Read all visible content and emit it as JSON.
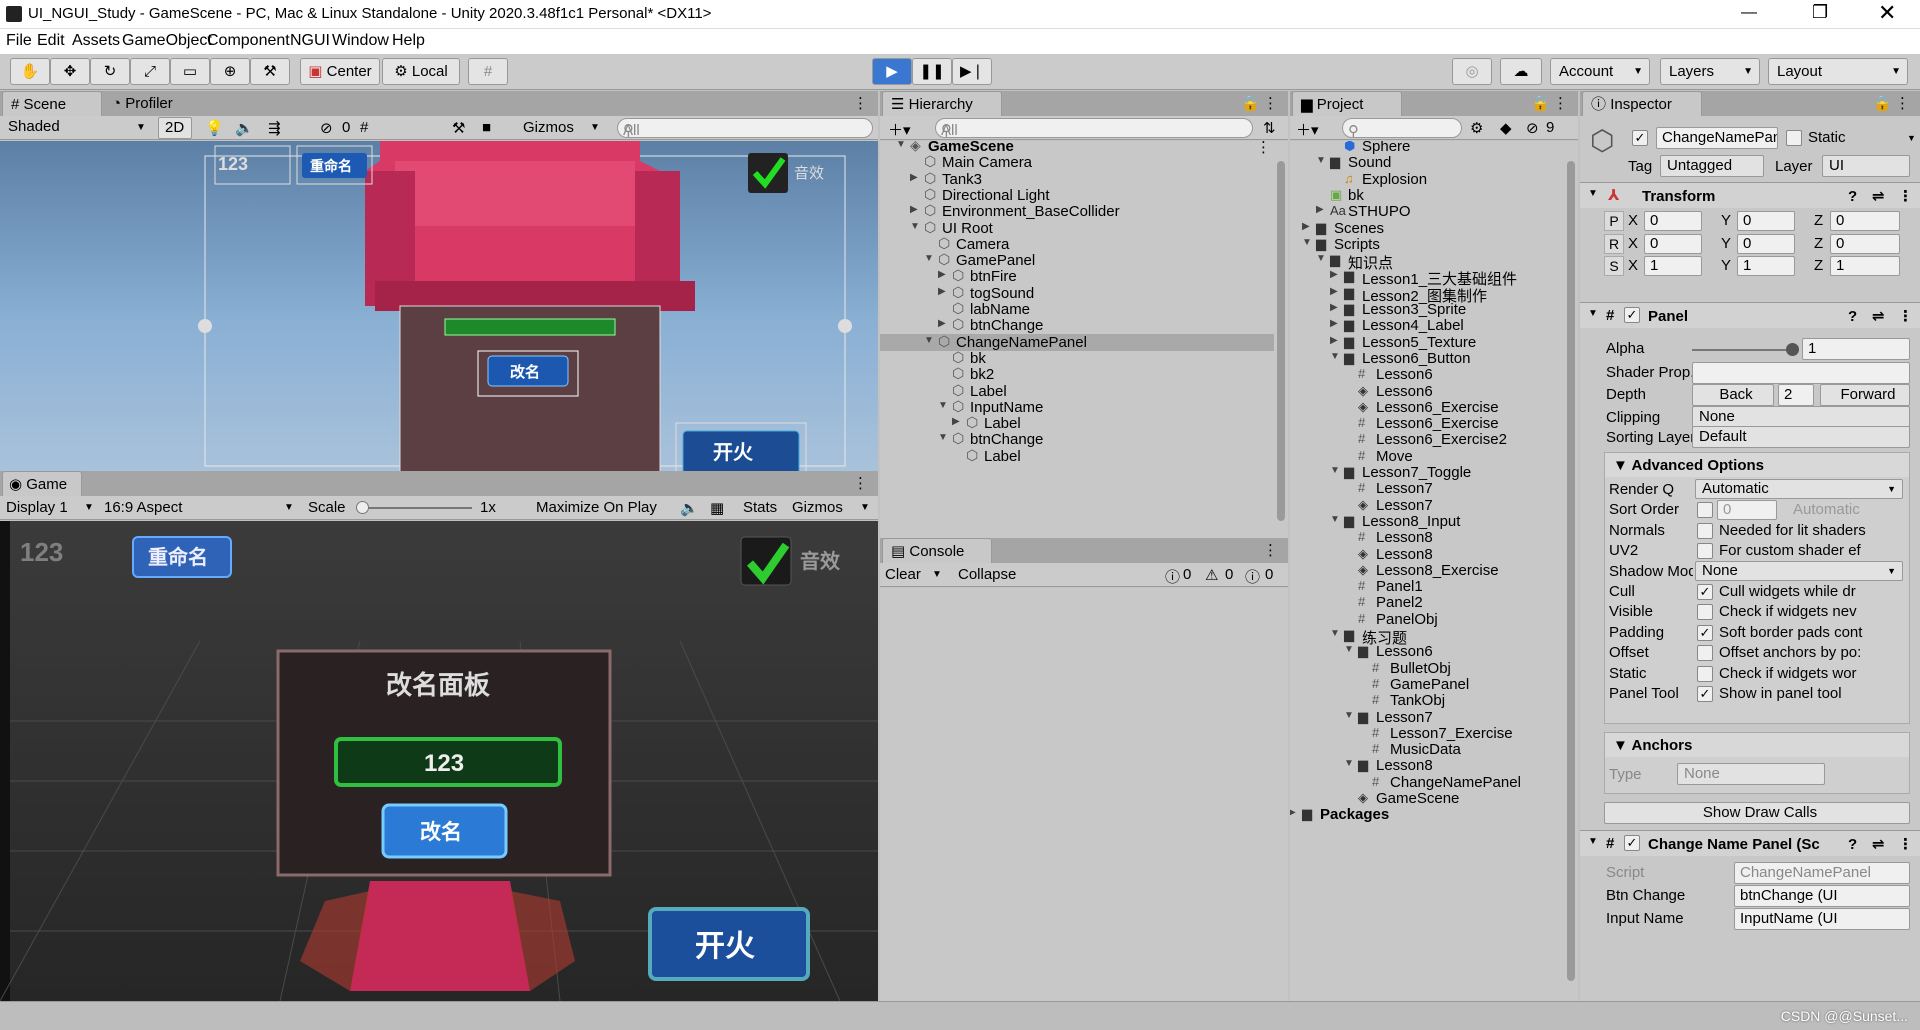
{
  "window": {
    "title": "UI_NGUI_Study - GameScene - PC, Mac & Linux Standalone - Unity 2020.3.48f1c1 Personal* <DX11>"
  },
  "menu": [
    "File",
    "Edit",
    "Assets",
    "GameObject",
    "Component",
    "NGUI",
    "Window",
    "Help"
  ],
  "toolbar": {
    "center": "Center",
    "local": "Local",
    "account": "Account",
    "layers": "Layers",
    "layout": "Layout"
  },
  "scene": {
    "tab": "Scene",
    "profiler_tab": "Profiler",
    "shading": "Shaded",
    "mode2d": "2D",
    "hidden_count": "0",
    "gizmos": "Gizmos",
    "search": "All",
    "overlay": {
      "label_123": "123",
      "rename_btn": "重命名",
      "sound_label": "音效",
      "rename2": "改名",
      "fire": "开火"
    }
  },
  "game": {
    "tab": "Game",
    "display": "Display 1",
    "aspect": "16:9 Aspect",
    "scale_label": "Scale",
    "scale_value": "1x",
    "maximize": "Maximize On Play",
    "stats": "Stats",
    "gizmos": "Gizmos",
    "ui": {
      "label_123": "123",
      "rename_btn": "重命名",
      "sound_label": "音效",
      "panel_title": "改名面板",
      "input_value": "123",
      "change_btn": "改名",
      "fire_btn": "开火"
    }
  },
  "hierarchy": {
    "tab": "Hierarchy",
    "search": "All",
    "items": [
      {
        "label": "GameScene",
        "depth": 0,
        "arrow": "down",
        "scene": true
      },
      {
        "label": "Main Camera",
        "depth": 1
      },
      {
        "label": "Tank3",
        "depth": 1,
        "arrow": "right"
      },
      {
        "label": "Directional Light",
        "depth": 1
      },
      {
        "label": "Environment_BaseCollider",
        "depth": 1,
        "arrow": "right"
      },
      {
        "label": "UI Root",
        "depth": 1,
        "arrow": "down"
      },
      {
        "label": "Camera",
        "depth": 2
      },
      {
        "label": "GamePanel",
        "depth": 2,
        "arrow": "down"
      },
      {
        "label": "btnFire",
        "depth": 3,
        "arrow": "right"
      },
      {
        "label": "togSound",
        "depth": 3,
        "arrow": "right"
      },
      {
        "label": "labName",
        "depth": 3
      },
      {
        "label": "btnChange",
        "depth": 3,
        "arrow": "right"
      },
      {
        "label": "ChangeNamePanel",
        "depth": 2,
        "arrow": "down",
        "selected": true
      },
      {
        "label": "bk",
        "depth": 3
      },
      {
        "label": "bk2",
        "depth": 3
      },
      {
        "label": "Label",
        "depth": 3
      },
      {
        "label": "InputName",
        "depth": 3,
        "arrow": "down"
      },
      {
        "label": "Label",
        "depth": 4,
        "arrow": "right"
      },
      {
        "label": "btnChange",
        "depth": 3,
        "arrow": "down"
      },
      {
        "label": "Label",
        "depth": 4
      }
    ]
  },
  "console": {
    "tab": "Console",
    "clear": "Clear",
    "collapse": "Collapse",
    "info_count": "0",
    "warn_count": "0",
    "error_count": "0"
  },
  "project": {
    "tab": "Project",
    "hidden_count": "9",
    "items": [
      {
        "label": "Sphere",
        "depth": 3,
        "icon": "prefab"
      },
      {
        "label": "Sound",
        "depth": 2,
        "icon": "folder",
        "arrow": "down"
      },
      {
        "label": "Explosion",
        "depth": 3,
        "icon": "audio"
      },
      {
        "label": "bk",
        "depth": 2,
        "icon": "image"
      },
      {
        "label": "STHUPO",
        "depth": 2,
        "icon": "font",
        "arrow": "right"
      },
      {
        "label": "Scenes",
        "depth": 1,
        "icon": "folder",
        "arrow": "right"
      },
      {
        "label": "Scripts",
        "depth": 1,
        "icon": "folder",
        "arrow": "down"
      },
      {
        "label": "知识点",
        "depth": 2,
        "icon": "folder",
        "arrow": "down"
      },
      {
        "label": "Lesson1_三大基础组件",
        "depth": 3,
        "icon": "folder",
        "arrow": "right"
      },
      {
        "label": "Lesson2_图集制作",
        "depth": 3,
        "icon": "folder",
        "arrow": "right"
      },
      {
        "label": "Lesson3_Sprite",
        "depth": 3,
        "icon": "folder",
        "arrow": "right"
      },
      {
        "label": "Lesson4_Label",
        "depth": 3,
        "icon": "folder",
        "arrow": "right"
      },
      {
        "label": "Lesson5_Texture",
        "depth": 3,
        "icon": "folder",
        "arrow": "right"
      },
      {
        "label": "Lesson6_Button",
        "depth": 3,
        "icon": "folder",
        "arrow": "down"
      },
      {
        "label": "Lesson6",
        "depth": 4,
        "icon": "script"
      },
      {
        "label": "Lesson6",
        "depth": 4,
        "icon": "scene"
      },
      {
        "label": "Lesson6_Exercise",
        "depth": 4,
        "icon": "scene"
      },
      {
        "label": "Lesson6_Exercise",
        "depth": 4,
        "icon": "script"
      },
      {
        "label": "Lesson6_Exercise2",
        "depth": 4,
        "icon": "script"
      },
      {
        "label": "Move",
        "depth": 4,
        "icon": "script"
      },
      {
        "label": "Lesson7_Toggle",
        "depth": 3,
        "icon": "folder",
        "arrow": "down"
      },
      {
        "label": "Lesson7",
        "depth": 4,
        "icon": "script"
      },
      {
        "label": "Lesson7",
        "depth": 4,
        "icon": "scene"
      },
      {
        "label": "Lesson8_Input",
        "depth": 3,
        "icon": "folder",
        "arrow": "down"
      },
      {
        "label": "Lesson8",
        "depth": 4,
        "icon": "script"
      },
      {
        "label": "Lesson8",
        "depth": 4,
        "icon": "scene"
      },
      {
        "label": "Lesson8_Exercise",
        "depth": 4,
        "icon": "scene"
      },
      {
        "label": "Panel1",
        "depth": 4,
        "icon": "script"
      },
      {
        "label": "Panel2",
        "depth": 4,
        "icon": "script"
      },
      {
        "label": "PanelObj",
        "depth": 4,
        "icon": "script"
      },
      {
        "label": "练习题",
        "depth": 3,
        "icon": "folder",
        "arrow": "down"
      },
      {
        "label": "Lesson6",
        "depth": 4,
        "icon": "folder",
        "arrow": "down"
      },
      {
        "label": "BulletObj",
        "depth": 5,
        "icon": "script"
      },
      {
        "label": "GamePanel",
        "depth": 5,
        "icon": "script"
      },
      {
        "label": "TankObj",
        "depth": 5,
        "icon": "script"
      },
      {
        "label": "Lesson7",
        "depth": 4,
        "icon": "folder",
        "arrow": "down"
      },
      {
        "label": "Lesson7_Exercise",
        "depth": 5,
        "icon": "script"
      },
      {
        "label": "MusicData",
        "depth": 5,
        "icon": "script"
      },
      {
        "label": "Lesson8",
        "depth": 4,
        "icon": "folder",
        "arrow": "down"
      },
      {
        "label": "ChangeNamePanel",
        "depth": 5,
        "icon": "script"
      },
      {
        "label": "GameScene",
        "depth": 4,
        "icon": "scene"
      },
      {
        "label": "Packages",
        "depth": 0,
        "icon": "folder",
        "arrow": "right",
        "bold": true
      }
    ]
  },
  "inspector": {
    "tab": "Inspector",
    "object_name": "ChangeNamePanel",
    "static": "Static",
    "tag_label": "Tag",
    "tag": "Untagged",
    "layer_label": "Layer",
    "layer": "UI",
    "transform": {
      "title": "Transform",
      "p": [
        "0",
        "0",
        "0"
      ],
      "r": [
        "0",
        "0",
        "0"
      ],
      "s": [
        "1",
        "1",
        "1"
      ],
      "row_labels": [
        "P",
        "R",
        "S"
      ],
      "axis": [
        "X",
        "Y",
        "Z"
      ]
    },
    "panel": {
      "title": "Panel",
      "alpha_label": "Alpha",
      "alpha": "1",
      "alpha_level": 1.0,
      "shader_label": "Shader Prop.",
      "depth_label": "Depth",
      "back": "Back",
      "depth": "2",
      "forward": "Forward",
      "clipping_label": "Clipping",
      "clipping": "None",
      "sorting_label": "Sorting Layer",
      "sorting": "Default"
    },
    "advanced": {
      "title": "Advanced Options",
      "rows": [
        {
          "label": "Render Q",
          "type": "drop",
          "value": "Automatic"
        },
        {
          "label": "Sort Order",
          "type": "sort",
          "value": "0",
          "hint": "Automatic"
        },
        {
          "label": "Normals",
          "checked": false,
          "hint": "Needed for lit shaders"
        },
        {
          "label": "UV2",
          "checked": false,
          "hint": "For custom shader ef"
        },
        {
          "label": "Shadow Mode",
          "type": "drop",
          "value": "None"
        },
        {
          "label": "Cull",
          "checked": true,
          "hint": "Cull widgets while dr"
        },
        {
          "label": "Visible",
          "checked": false,
          "hint": "Check if widgets nev"
        },
        {
          "label": "Padding",
          "checked": true,
          "hint": "Soft border pads cont"
        },
        {
          "label": "Offset",
          "checked": false,
          "hint": "Offset anchors by po:"
        },
        {
          "label": "Static",
          "checked": false,
          "hint": "Check if widgets wor"
        },
        {
          "label": "Panel Tool",
          "checked": true,
          "hint": "Show in panel tool"
        }
      ]
    },
    "anchors": {
      "title": "Anchors",
      "type_label": "Type",
      "type": "None"
    },
    "draw_calls": "Show Draw Calls",
    "script_comp": {
      "title": "Change Name Panel (Sc",
      "script_label": "Script",
      "script": "ChangeNamePanel",
      "btn_label": "Btn Change",
      "btn": "btnChange (UI",
      "input_label": "Input Name",
      "input": "InputName (UI"
    }
  },
  "watermark": "CSDN @@Sunset...",
  "colors": {
    "selected": "#8fa6c4",
    "hier_bg": "#c8c8c8",
    "panel_bg": "#c2c2c2",
    "tab_bg": "#a5a5a5"
  }
}
